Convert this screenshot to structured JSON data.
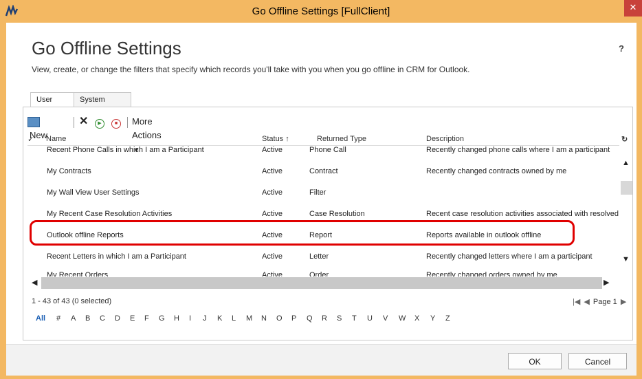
{
  "window": {
    "title": "Go Offline Settings [FullClient]",
    "close_glyph": "✕",
    "logo_icon": "crm-logo-icon",
    "frame_color": "#f3b862",
    "close_color": "#c8423a"
  },
  "page": {
    "heading": "Go Offline Settings",
    "help": "?",
    "subtitle": "View, create, or change the filters that specify which records you'll take with you when you go offline in CRM for Outlook."
  },
  "tabs": [
    {
      "label": "User Filters",
      "active": true
    },
    {
      "label": "System Filters",
      "active": false
    }
  ],
  "toolbar": {
    "new_label": "New",
    "delete_icon": "delete-icon",
    "activate_icon": "activate-icon",
    "deactivate_icon": "deactivate-icon",
    "more_actions_label": "More Actions",
    "more_actions_arrow": "▾"
  },
  "grid": {
    "headers": {
      "check": "✓",
      "name": "Name",
      "status": "Status ↑",
      "returned_type": "Returned Type",
      "description": "Description",
      "refresh": "↻"
    },
    "rows": [
      {
        "name": "Recent Phone Calls in which I am a Participant",
        "status": "Active",
        "type": "Phone Call",
        "description": "Recently changed phone calls where I am a participant"
      },
      {
        "name": "My Contracts",
        "status": "Active",
        "type": "Contract",
        "description": "Recently changed contracts owned by me"
      },
      {
        "name": "My Wall View User Settings",
        "status": "Active",
        "type": "Filter",
        "description": ""
      },
      {
        "name": "My Recent Case Resolution Activities",
        "status": "Active",
        "type": "Case Resolution",
        "description": "Recent case resolution activities associated with resolved"
      },
      {
        "name": "Outlook offline Reports",
        "status": "Active",
        "type": "Report",
        "description": "Reports available in outlook offline"
      },
      {
        "name": "Recent Letters in which I am a Participant",
        "status": "Active",
        "type": "Letter",
        "description": "Recently changed letters where I am a participant"
      },
      {
        "name": "My Recent Orders",
        "status": "Active",
        "type": "Order",
        "description": "Recently changed orders owned by me"
      }
    ],
    "highlight_color": "#e00000",
    "scroll_up": "▲",
    "scroll_down": "▼",
    "scroll_left": "◀",
    "scroll_right": "▶"
  },
  "footer": {
    "record_count": "1 - 43 of 43 (0 selected)",
    "pager_first": "|◀",
    "pager_prev": "◀",
    "pager_label": "Page 1",
    "pager_next": "▶",
    "alphabet": [
      "All",
      "#",
      "A",
      "B",
      "C",
      "D",
      "E",
      "F",
      "G",
      "H",
      "I",
      "J",
      "K",
      "L",
      "M",
      "N",
      "O",
      "P",
      "Q",
      "R",
      "S",
      "T",
      "U",
      "V",
      "W",
      "X",
      "Y",
      "Z"
    ]
  },
  "buttons": {
    "ok": "OK",
    "cancel": "Cancel"
  }
}
